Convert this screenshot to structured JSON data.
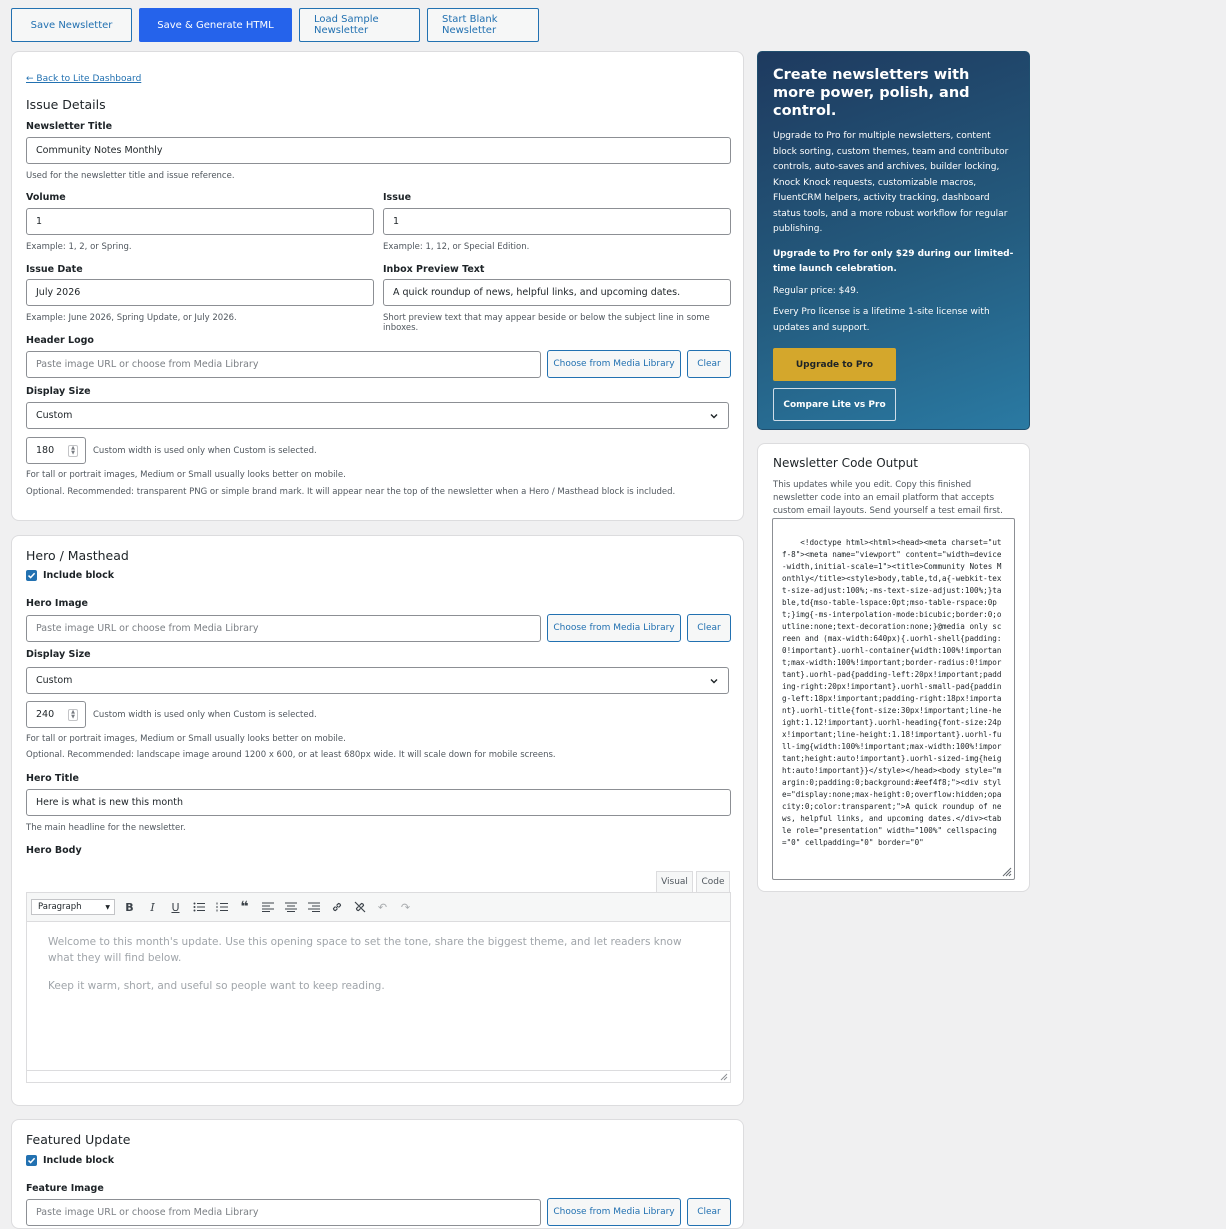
{
  "toolbar": {
    "save": "Save Newsletter",
    "save_generate": "Save & Generate HTML",
    "load_sample": "Load Sample Newsletter",
    "start_blank": "Start Blank Newsletter"
  },
  "issue": {
    "back_link": "← Back to Lite Dashboard",
    "heading": "Issue Details",
    "title_label": "Newsletter Title",
    "title_value": "Community Notes Monthly",
    "title_help": "Used for the newsletter title and issue reference.",
    "volume_label": "Volume",
    "volume_value": "1",
    "volume_help": "Example: 1, 2, or Spring.",
    "issue_label": "Issue",
    "issue_value": "1",
    "issue_help": "Example: 1, 12, or Special Edition.",
    "date_label": "Issue Date",
    "date_value": "July 2026",
    "date_help": "Example: June 2026, Spring Update, or July 2026.",
    "preview_label": "Inbox Preview Text",
    "preview_value": "A quick roundup of news, helpful links, and upcoming dates.",
    "preview_help": "Short preview text that may appear beside or below the subject line in some inboxes.",
    "logo_label": "Header Logo",
    "logo_placeholder": "Paste image URL or choose from Media Library",
    "media_button": "Choose from Media Library",
    "clear_button": "Clear",
    "display_label": "Display Size",
    "display_value": "Custom",
    "width_value": "180",
    "width_help": "Custom width is used only when Custom is selected.",
    "mobile_help": "For tall or portrait images, Medium or Small usually looks better on mobile.",
    "logo_help": "Optional. Recommended: transparent PNG or simple brand mark. It will appear near the top of the newsletter when a Hero / Masthead block is included."
  },
  "hero": {
    "heading": "Hero / Masthead",
    "include": "Include block",
    "image_label": "Hero Image",
    "image_placeholder": "Paste image URL or choose from Media Library",
    "media_button": "Choose from Media Library",
    "clear_button": "Clear",
    "display_label": "Display Size",
    "display_value": "Custom",
    "width_value": "240",
    "width_help": "Custom width is used only when Custom is selected.",
    "mobile_help": "For tall or portrait images, Medium or Small usually looks better on mobile.",
    "image_help": "Optional. Recommended: landscape image around 1200 x 600, or at least 680px wide. It will scale down for mobile screens.",
    "title_label": "Hero Title",
    "title_value": "Here is what is new this month",
    "title_help": "The main headline for the newsletter.",
    "body_label": "Hero Body",
    "tab_visual": "Visual",
    "tab_code": "Code",
    "format_value": "Paragraph",
    "body_p1": "Welcome to this month's update. Use this opening space to set the tone, share the biggest theme, and let readers know what they will find below.",
    "body_p2": "Keep it warm, short, and useful so people want to keep reading."
  },
  "featured": {
    "heading": "Featured Update",
    "include": "Include block",
    "image_label": "Feature Image",
    "image_placeholder": "Paste image URL or choose from Media Library",
    "media_button": "Choose from Media Library",
    "clear_button": "Clear"
  },
  "promo": {
    "title": "Create newsletters with more power, polish, and control.",
    "p1": "Upgrade to Pro for multiple newsletters, content block sorting, custom themes, team and contributor controls, auto-saves and archives, builder locking, Knock Knock requests, customizable macros, FluentCRM helpers, activity tracking, dashboard status tools, and a more robust workflow for regular publishing.",
    "p2": "Upgrade to Pro for only $29 during our limited-time launch celebration.",
    "p3": "Regular price: $49.",
    "p4": "Every Pro license is a lifetime 1-site license with updates and support.",
    "upgrade_button": "Upgrade to Pro",
    "compare_button": "Compare Lite vs Pro"
  },
  "code_output": {
    "title": "Newsletter Code Output",
    "help": "This updates while you edit. Copy this finished newsletter code into an email platform that accepts custom email layouts. Send yourself a test email first.",
    "code": "<!doctype html><html><head><meta charset=\"utf-8\"><meta name=\"viewport\" content=\"width=device-width,initial-scale=1\"><title>Community Notes Monthly</title><style>body,table,td,a{-webkit-text-size-adjust:100%;-ms-text-size-adjust:100%;}table,td{mso-table-lspace:0pt;mso-table-rspace:0pt;}img{-ms-interpolation-mode:bicubic;border:0;outline:none;text-decoration:none;}@media only screen and (max-width:640px){.uorhl-shell{padding:0!important}.uorhl-container{width:100%!important;max-width:100%!important;border-radius:0!important}.uorhl-pad{padding-left:20px!important;padding-right:20px!important}.uorhl-small-pad{padding-left:18px!important;padding-right:18px!important}.uorhl-title{font-size:30px!important;line-height:1.12!important}.uorhl-heading{font-size:24px!important;line-height:1.18!important}.uorhl-full-img{width:100%!important;max-width:100%!important;height:auto!important}.uorhl-sized-img{height:auto!important}}</style></head><body style=\"margin:0;padding:0;background:#eef4f8;\"><div style=\"display:none;max-height:0;overflow:hidden;opacity:0;color:transparent;\">A quick roundup of news, helpful links, and upcoming dates.</div><table role=\"presentation\" width=\"100%\" cellspacing=\"0\" cellpadding=\"0\" border=\"0\""
  }
}
